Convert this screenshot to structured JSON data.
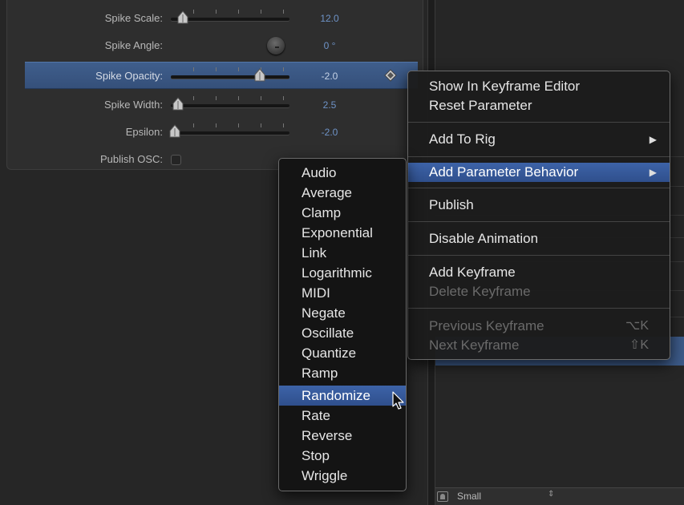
{
  "parameters": [
    {
      "label": "Spike Scale:",
      "value": "12.0",
      "control": "slider",
      "slider_position": 0.1
    },
    {
      "label": "Spike Angle:",
      "value": "0 °",
      "control": "dial"
    },
    {
      "label": "Spike Opacity:",
      "value": "-2.0",
      "control": "slider",
      "slider_position": 0.75,
      "selected": true
    },
    {
      "label": "Spike Width:",
      "value": "2.5",
      "control": "slider",
      "slider_position": 0.05
    },
    {
      "label": "Epsilon:",
      "value": "-2.0",
      "control": "slider",
      "slider_position": 0.02
    },
    {
      "label": "Publish OSC:",
      "control": "checkbox",
      "checked": false
    }
  ],
  "context_menu": {
    "items": [
      {
        "label": "Show In Keyframe Editor",
        "enabled": true
      },
      {
        "label": "Reset Parameter",
        "enabled": true
      },
      {
        "label": "Add To Rig",
        "enabled": true,
        "submenu": true
      },
      {
        "label": "Add Parameter Behavior",
        "enabled": true,
        "submenu": true,
        "highlighted": true
      },
      {
        "label": "Publish",
        "enabled": true
      },
      {
        "label": "Disable Animation",
        "enabled": true
      },
      {
        "label": "Add Keyframe",
        "enabled": true
      },
      {
        "label": "Delete Keyframe",
        "enabled": false
      },
      {
        "label": "Previous Keyframe",
        "enabled": false,
        "shortcut": "⌥K"
      },
      {
        "label": "Next Keyframe",
        "enabled": false,
        "shortcut": "⇧K"
      }
    ],
    "arrow_glyph": "▶"
  },
  "behavior_submenu": {
    "items": [
      "Audio",
      "Average",
      "Clamp",
      "Exponential",
      "Link",
      "Logarithmic",
      "MIDI",
      "Negate",
      "Oscillate",
      "Quantize",
      "Ramp",
      "Randomize",
      "Rate",
      "Reverse",
      "Stop",
      "Wriggle"
    ],
    "highlighted": "Randomize"
  },
  "bottom_bar": {
    "size_popup": {
      "label": "Small",
      "arrows": "⇕",
      "icon": "person-thumbnail-icon"
    }
  },
  "colors": {
    "accent": "#3d63a8",
    "value_text": "#6e93c7",
    "selected_row": "#3f5e8c"
  }
}
